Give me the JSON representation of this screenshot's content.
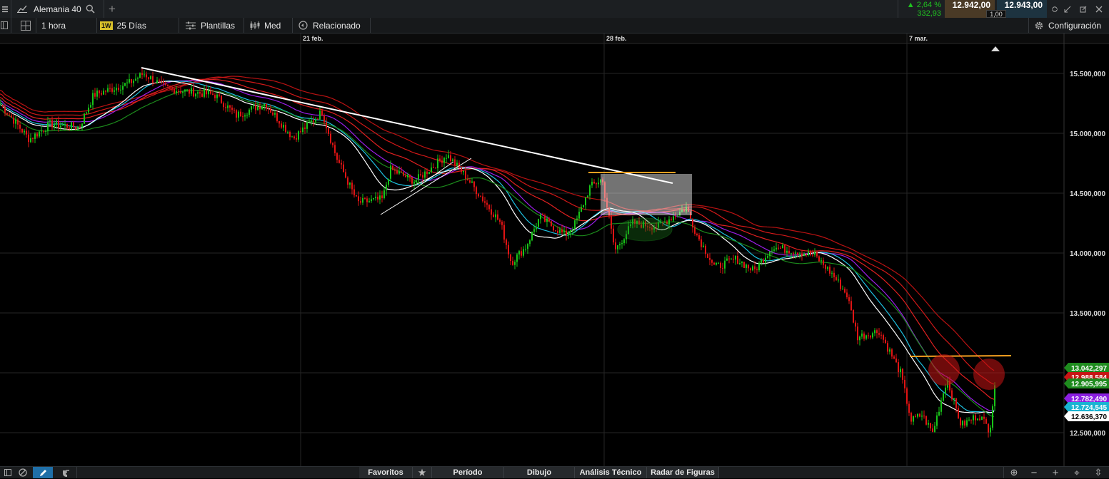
{
  "toolbar": {
    "instrument": "Alemania 40",
    "change_pct": "▲ 2,64 %",
    "change_abs": "332,93",
    "sell_price": "12.942,00",
    "buy_price": "12.943,00",
    "spread": "1,00"
  },
  "chart_toolbar": {
    "interval": "1 hora",
    "range_badge": "1W",
    "range": "25 Días",
    "templates": "Plantillas",
    "price_type": "Med",
    "related": "Relacionado",
    "settings": "Configuración"
  },
  "chart_data": {
    "type": "candlestick",
    "title": "",
    "x_labels": [
      "21 feb.",
      "28 feb.",
      "7 mar."
    ],
    "y_ticks": [
      "15.500,000",
      "15.000,000",
      "14.500,000",
      "14.000,000",
      "13.500,000",
      "12.500,000"
    ],
    "ylim": [
      12400,
      15720
    ],
    "grid": true,
    "price_tags": [
      {
        "label": "13.042,297",
        "color": "#1e8b1e"
      },
      {
        "label": "12.988,584",
        "color": "#c81414"
      },
      {
        "label": "12.905,995",
        "color": "#1e8b1e"
      },
      {
        "label": "12.782,490",
        "color": "#8b1ee0"
      },
      {
        "label": "12.724,545",
        "color": "#19b4d2"
      },
      {
        "label": "12.636,370",
        "color": "#ffffff"
      }
    ],
    "annotations": [
      "descending trendline",
      "resistance levels",
      "consolidation box",
      "highlighted rejection candles"
    ]
  },
  "bottom_bar": {
    "tabs": [
      "Favoritos",
      "Período",
      "Dibujo",
      "Análisis Técnico",
      "Radar de Figuras"
    ]
  },
  "colors": {
    "bull": "#18c418",
    "bear": "#e01414",
    "toolbar_bg": "#1c1f22",
    "sell_bg": "#4a3a26",
    "buy_bg": "#1d3340"
  }
}
